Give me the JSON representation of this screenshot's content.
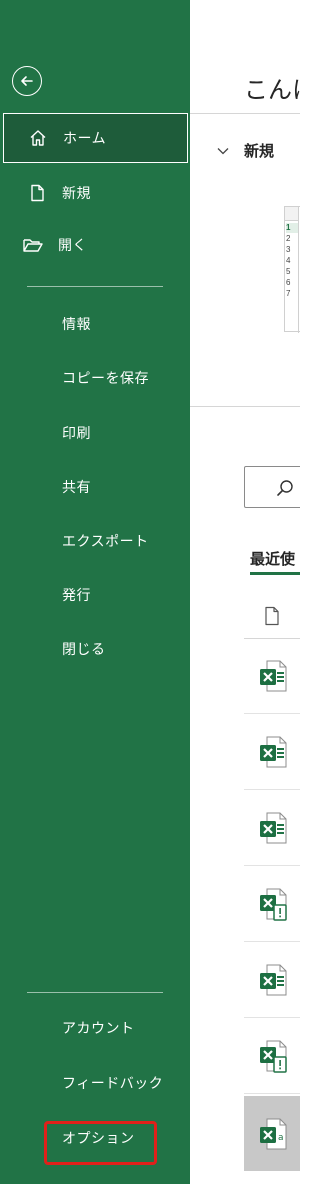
{
  "sidebar": {
    "back_label": "",
    "nav": [
      {
        "label": "ホーム",
        "icon": "home-icon",
        "selected": true
      },
      {
        "label": "新規",
        "icon": "new-document-icon",
        "selected": false
      },
      {
        "label": "開く",
        "icon": "open-folder-icon",
        "selected": false
      }
    ],
    "sub": [
      {
        "label": "情報"
      },
      {
        "label": "コピーを保存"
      },
      {
        "label": "印刷"
      },
      {
        "label": "共有"
      },
      {
        "label": "エクスポート"
      },
      {
        "label": "発行"
      },
      {
        "label": "閉じる"
      }
    ],
    "bottom": [
      {
        "label": "アカウント"
      },
      {
        "label": "フィードバック"
      },
      {
        "label": "オプション",
        "highlighted": true
      }
    ],
    "colors": {
      "background": "#217346",
      "selected": "#1e5c3a",
      "highlight": "#e0201a"
    }
  },
  "main": {
    "greeting": "こんに",
    "new_section_label": "新規",
    "recent_label": "最近使",
    "thumbnail_rows": [
      "1",
      "2",
      "3",
      "4",
      "5",
      "6",
      "7"
    ],
    "files": [
      {
        "icon": "excel-file-icon"
      },
      {
        "icon": "excel-file-icon"
      },
      {
        "icon": "excel-file-icon"
      },
      {
        "icon": "excel-file-warning-icon"
      },
      {
        "icon": "excel-file-icon"
      },
      {
        "icon": "excel-file-warning-icon"
      },
      {
        "icon": "excel-template-icon",
        "selected": true
      }
    ]
  }
}
